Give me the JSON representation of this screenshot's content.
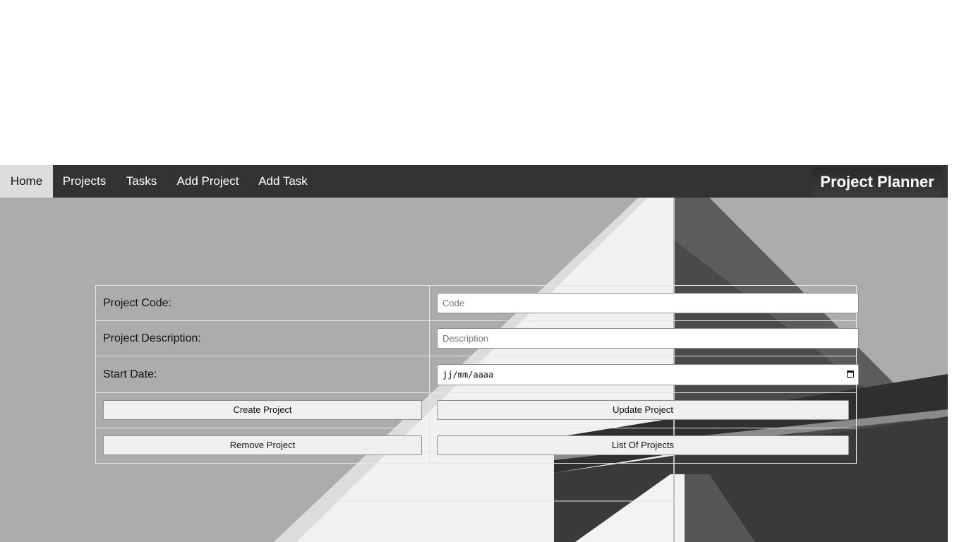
{
  "nav": {
    "items": [
      {
        "label": "Home",
        "active": true
      },
      {
        "label": "Projects",
        "active": false
      },
      {
        "label": "Tasks",
        "active": false
      },
      {
        "label": "Add Project",
        "active": false
      },
      {
        "label": "Add Task",
        "active": false
      }
    ],
    "brand": "Project Planner",
    "bar_color": "#333333",
    "active_color": "#dddddd"
  },
  "form": {
    "code_label": "Project Code:",
    "code_placeholder": "Code",
    "description_label": "Project Description:",
    "description_placeholder": "Description",
    "start_date_label": "Start Date:",
    "start_date_placeholder": "jj/mm/aaaa",
    "create_button": "Create Project",
    "update_button": "Update Project",
    "remove_button": "Remove Project",
    "list_button": "List Of Projects"
  },
  "icons": {
    "calendar": "calendar-icon"
  }
}
